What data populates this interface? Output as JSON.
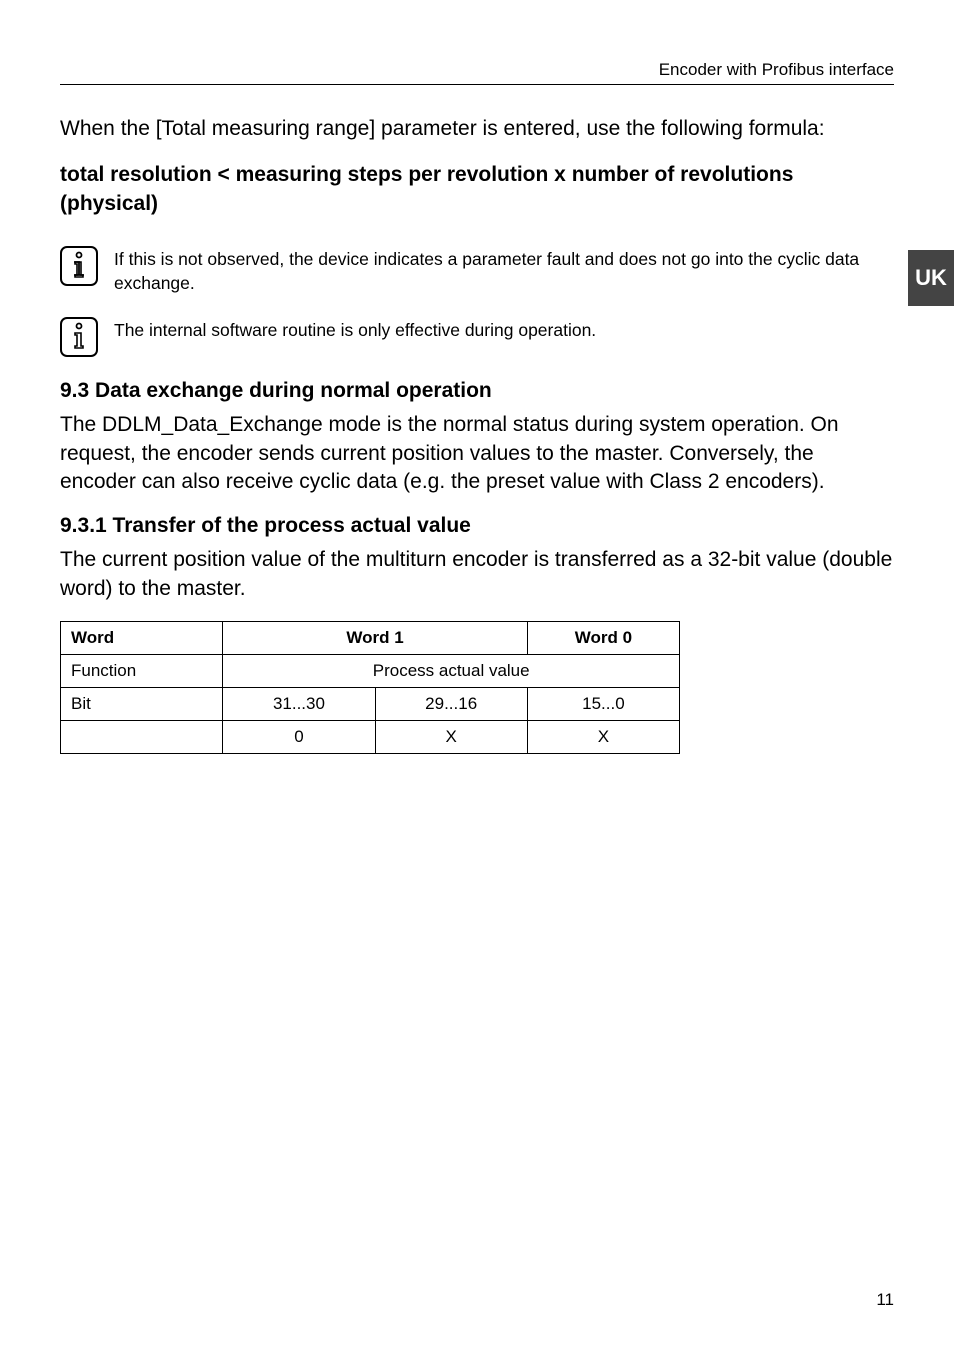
{
  "header": {
    "title": "Encoder with Profibus interface"
  },
  "sidebar": {
    "tab": "UK"
  },
  "content": {
    "intro": "When the [Total measuring range] parameter is entered, use the following formula:",
    "formula": "total resolution < measuring steps per revolution x number of revolutions (physical)",
    "note1": "If this is not observed, the device indicates a parameter fault and does not go into the cyclic data exchange.",
    "note2": "The internal software routine is only effective during operation.",
    "section_9_3_heading": "9.3  Data exchange during normal operation",
    "section_9_3_body": "The DDLM_Data_Exchange mode is the normal status during system operation. On request, the encoder sends current position values to the master. Conversely, the encoder can also receive cyclic data (e.g. the preset value with Class 2 encoders).",
    "section_9_3_1_heading": "9.3.1  Transfer of the process actual value",
    "section_9_3_1_body": "The current position value of the multiturn encoder is transferred as a 32-bit value (double word) to the master."
  },
  "table": {
    "r1c1": "Word",
    "r1c2": "Word 1",
    "r1c3": "Word 0",
    "r2c1": "Function",
    "r2c2": "Process actual value",
    "r3c1": "Bit",
    "r3c2": "31...30",
    "r3c3": "29...16",
    "r3c4": "15...0",
    "r4c1": "",
    "r4c2": "0",
    "r4c3": "X",
    "r4c4": "X"
  },
  "footer": {
    "page": "11"
  }
}
